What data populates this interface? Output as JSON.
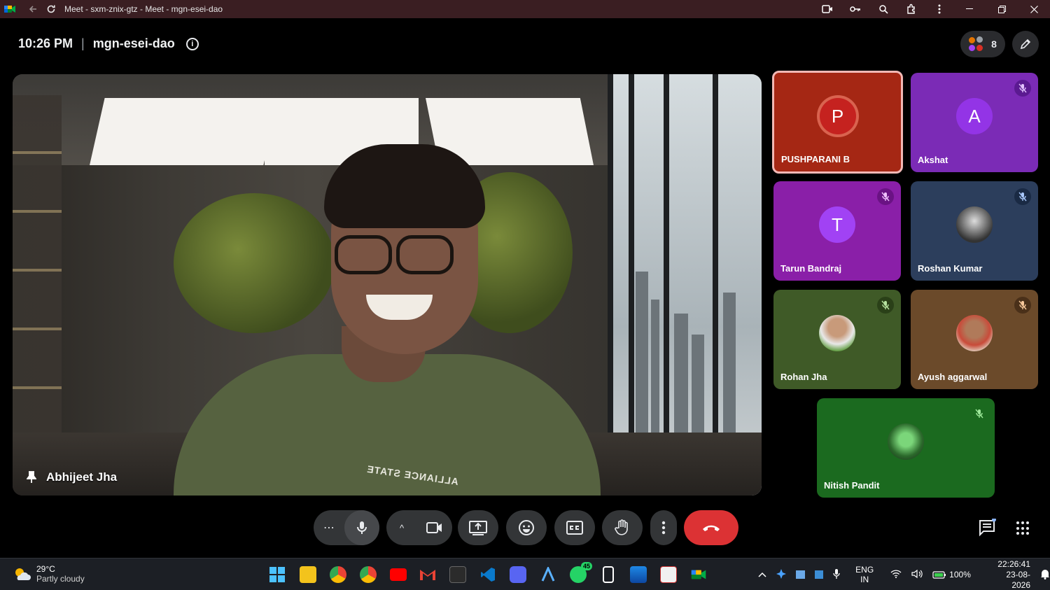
{
  "window": {
    "title": "Meet - sxm-znix-gtz - Meet - mgn-esei-dao"
  },
  "meeting": {
    "time": "10:26 PM",
    "separator": "|",
    "code": "mgn-esei-dao",
    "info_icon": "i",
    "participant_count": "8"
  },
  "main_video": {
    "name": "Abhijeet Jha",
    "shirt_text": "ALLIANCE STATE"
  },
  "tiles": [
    {
      "name": "PUSHPARANI B",
      "initial": "P",
      "muted": false,
      "pinned_highlight": true
    },
    {
      "name": "Akshat",
      "initial": "A",
      "muted": true
    },
    {
      "name": "Tarun Bandraj",
      "initial": "T",
      "muted": true
    },
    {
      "name": "Roshan Kumar",
      "initial": "",
      "muted": true
    },
    {
      "name": "Rohan Jha",
      "initial": "",
      "muted": true
    },
    {
      "name": "Ayush aggarwal",
      "initial": "",
      "muted": true
    },
    {
      "name": "Nitish Pandit",
      "initial": "",
      "muted": true
    }
  ],
  "controls": {
    "more_label": "⋯",
    "caret": "^"
  },
  "taskbar": {
    "weather_temp": "29°C",
    "weather_desc": "Partly cloudy",
    "whatsapp_badge": "45",
    "lang": "ENG",
    "region": "IN",
    "battery": "100%",
    "time": "22:26:41",
    "date": "23-08-2026"
  },
  "colors": {
    "end_call": "#dc3234",
    "title_bar": "#3a1e22",
    "control_bg": "#333537",
    "highlight_border": "#f2b8b5"
  }
}
